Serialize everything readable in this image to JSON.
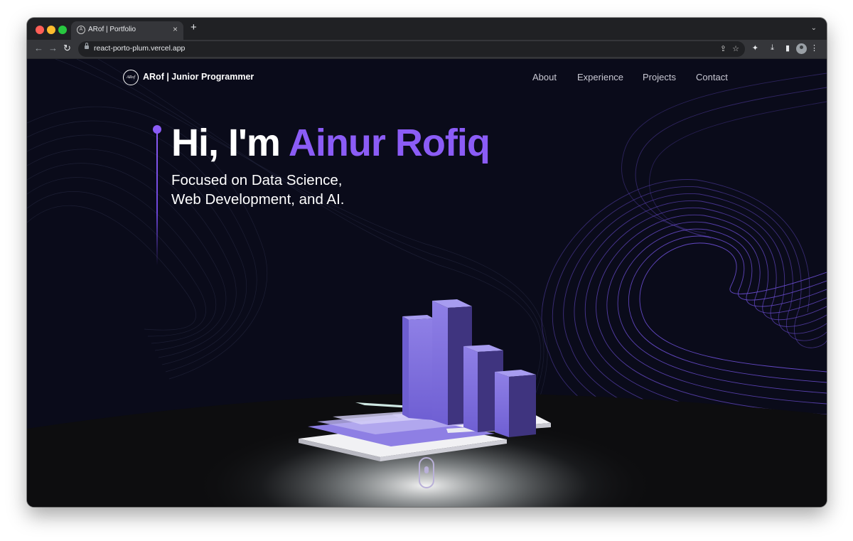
{
  "browser": {
    "tab_title": "ARof | Portfolio",
    "tab_favicon": "ARof-circle-logo",
    "tab_close": "×",
    "new_tab": "+",
    "tab_menu": "⌄",
    "url": "react-porto-plum.vercel.app",
    "icons": [
      "back-arrow",
      "forward-arrow",
      "reload",
      "lock",
      "share",
      "star",
      "extensions-puzzle",
      "download",
      "side-panel",
      "profile-avatar",
      "kebab-menu"
    ]
  },
  "navbar": {
    "logo_text": "ARof",
    "brand": "ARof | Junior Programmer",
    "links": [
      "About",
      "Experience",
      "Projects",
      "Contact"
    ]
  },
  "hero": {
    "greeting": "Hi, I'm",
    "name": "Ainur Rofiq",
    "subtitle_line1": "Focused on Data Science,",
    "subtitle_line2": "Web Development, and AI."
  },
  "colors": {
    "accent": "#8b5cf6",
    "background": "#0a0b1a",
    "text": "#ffffff",
    "nav_text": "#c9c9d4"
  }
}
